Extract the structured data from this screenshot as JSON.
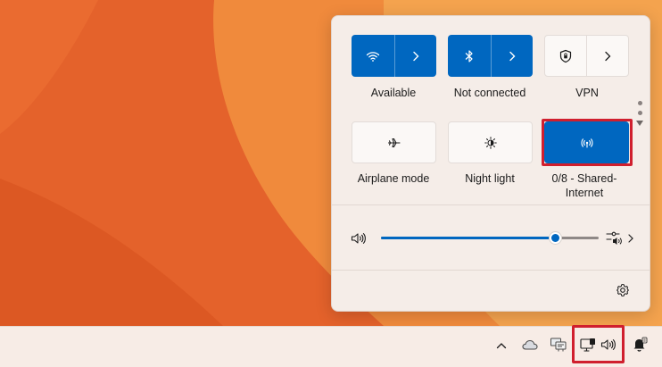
{
  "wallpaper": {
    "colors": {
      "base": "#e8632a",
      "light": "#f2a050",
      "dark": "#d6521f"
    }
  },
  "quick_settings": {
    "tiles": [
      {
        "id": "wifi",
        "label": "Available",
        "state": "on",
        "icon": "wifi-icon",
        "has_arrow": true
      },
      {
        "id": "bluetooth",
        "label": "Not connected",
        "state": "on",
        "icon": "bluetooth-icon",
        "has_arrow": true
      },
      {
        "id": "vpn",
        "label": "VPN",
        "state": "off",
        "icon": "shield-icon",
        "has_arrow": true
      },
      {
        "id": "airplane",
        "label": "Airplane mode",
        "state": "off",
        "icon": "airplane-icon",
        "has_arrow": false
      },
      {
        "id": "night_light",
        "label": "Night light",
        "state": "off",
        "icon": "brightness-icon",
        "has_arrow": false
      },
      {
        "id": "hotspot",
        "label": "0/8 - Shared-Internet",
        "state": "on",
        "icon": "hotspot-icon",
        "has_arrow": false,
        "highlighted": true
      }
    ],
    "pager": {
      "pages": 2,
      "current": 1
    },
    "volume": {
      "level": 0.8,
      "icon": "speaker-icon"
    },
    "mixer_icon": "sound-mixer-icon",
    "settings_icon": "gear-icon"
  },
  "taskbar": {
    "tray_icons": [
      "chevron-up-icon",
      "onedrive-cloud-icon",
      "network-adapter-icon",
      "network-monitor-icon",
      "speaker-icon",
      "notification-icon"
    ],
    "highlighted_group": [
      "network-monitor-icon",
      "speaker-icon"
    ]
  },
  "colors": {
    "accent": "#0067c0",
    "highlight": "#d01f2e",
    "flyout_bg": "#f5ede8"
  }
}
